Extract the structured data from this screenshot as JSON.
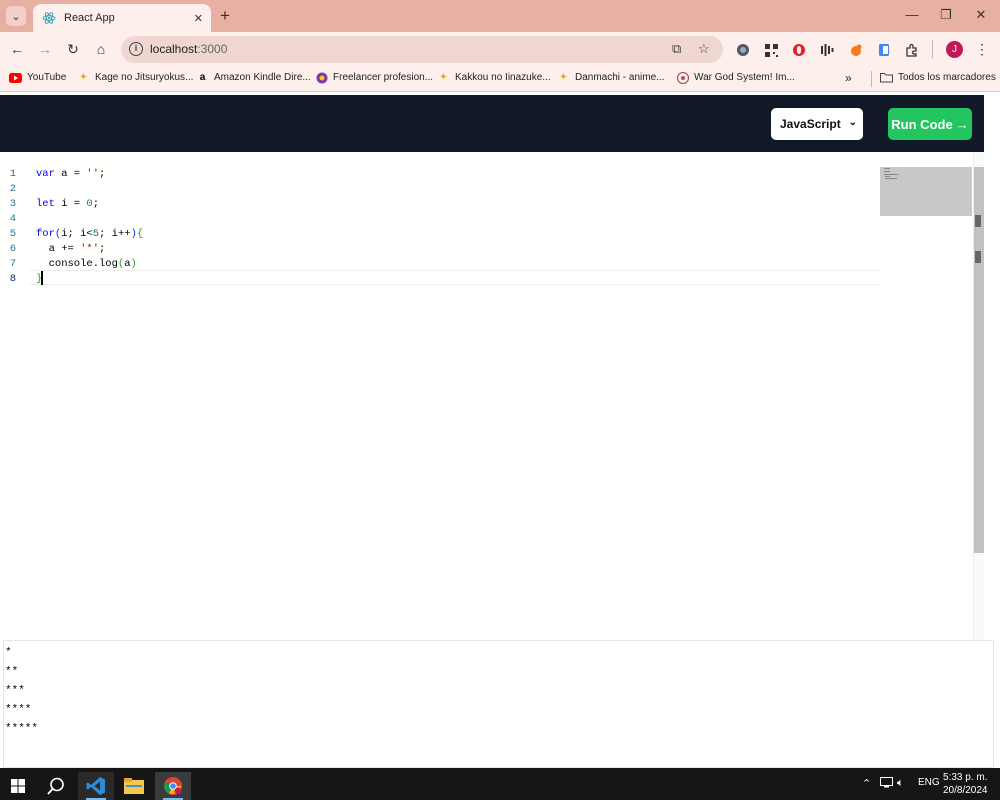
{
  "browser": {
    "tab_title": "React App",
    "url_host": "localhost",
    "url_port": ":3000",
    "profile_initial": "J",
    "bookmarks": [
      "YouTube",
      "Kage no Jitsuryokus...",
      "Amazon Kindle Dire...",
      "Freelancer profesion...",
      "Kakkou no Iinazuke...",
      "Danmachi - anime...",
      "War God System! Im..."
    ],
    "all_bookmarks": "Todos los marcadores"
  },
  "app": {
    "language": "JavaScript",
    "run_label": "Run Code",
    "run_arrow": "→"
  },
  "editor": {
    "line_numbers": [
      "1",
      "2",
      "3",
      "4",
      "5",
      "6",
      "7",
      "8"
    ]
  },
  "output": {
    "lines": [
      "*",
      "**",
      "***",
      "****",
      "*****"
    ]
  },
  "taskbar": {
    "lang": "ENG",
    "time": "5:33 p. m.",
    "date": "20/8/2024"
  },
  "colors": {
    "header_bg": "#111827",
    "run_button": "#22c55e",
    "chrome_frame": "#e8afa3"
  }
}
